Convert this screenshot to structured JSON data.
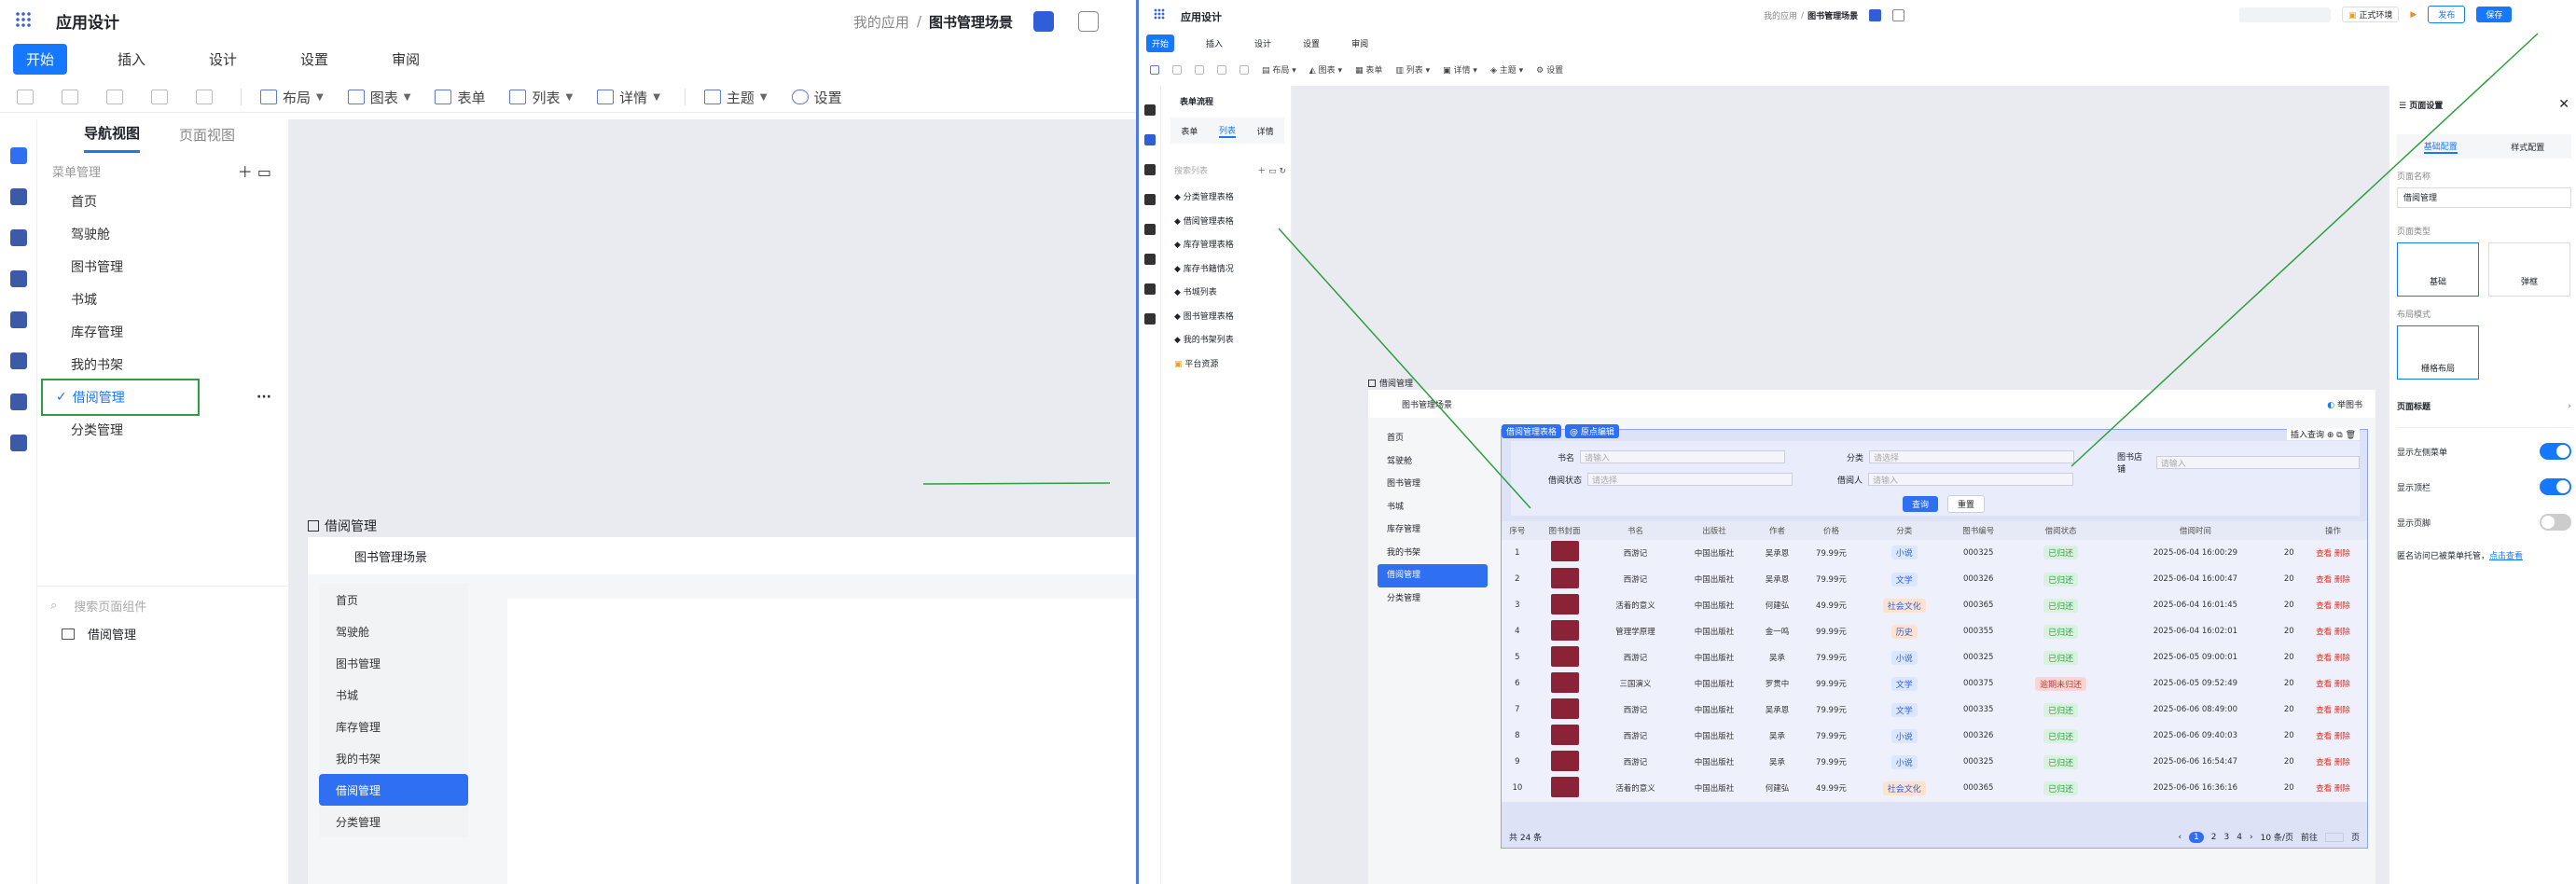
{
  "left": {
    "app_title": "应用设计",
    "breadcrumb": {
      "parent": "我的应用",
      "sep": "/",
      "current": "图书管理场景"
    },
    "tabs": [
      "开始",
      "插入",
      "设计",
      "设置",
      "审阅"
    ],
    "toolbar": {
      "layout": "布局",
      "chart": "图表",
      "form": "表单",
      "list": "列表",
      "detail": "详情",
      "theme": "主题",
      "settings": "设置"
    },
    "view_tabs": [
      "导航视图",
      "页面视图"
    ],
    "menu_section": "菜单管理",
    "menu_items": [
      "首页",
      "驾驶舱",
      "图书管理",
      "书城",
      "库存管理",
      "我的书架",
      "借阅管理",
      "分类管理"
    ],
    "more": "···",
    "search_placeholder": "搜索页面组件",
    "page_component": "借阅管理",
    "preview": {
      "title": "借阅管理",
      "scene": "图书管理场景",
      "menu": [
        "首页",
        "驾驶舱",
        "图书管理",
        "书城",
        "库存管理",
        "我的书架",
        "借阅管理",
        "分类管理"
      ]
    }
  },
  "right": {
    "app_title": "应用设计",
    "breadcrumb": {
      "parent": "我的应用",
      "sep": "/",
      "current": "图书管理场景"
    },
    "tabs": [
      "开始",
      "插入",
      "设计",
      "设置",
      "审阅"
    ],
    "env": "正式环境",
    "publish": "发布",
    "save": "保存",
    "toolbar": {
      "layout": "布局",
      "chart": "图表",
      "form": "表单",
      "list": "列表",
      "detail": "详情",
      "theme": "主题",
      "settings": "设置"
    },
    "flow_title": "表单流程",
    "flow_tabs": [
      "表单",
      "列表",
      "详情"
    ],
    "search_list": "搜索列表",
    "list_items": [
      "分类管理表格",
      "借阅管理表格",
      "库存管理表格",
      "库存书籍情况",
      "书城列表",
      "图书管理表格",
      "我的书架列表"
    ],
    "platform": "平台资源",
    "preview": {
      "title": "借阅管理",
      "scene": "图书管理场景",
      "book_btn": "举图书",
      "menu": [
        "首页",
        "驾驶舱",
        "图书管理",
        "书城",
        "库存管理",
        "我的书架",
        "借阅管理",
        "分类管理"
      ],
      "tag1": "借阅管理表格",
      "tag2": "@ 原点编辑",
      "actions": "插入查询",
      "filters": {
        "f1": "书名",
        "f1_ph": "请输入",
        "f2": "分类",
        "f2_ph": "请选择",
        "f3": "图书店铺",
        "f3_ph": "请输入",
        "f4": "借阅状态",
        "f4_ph": "请选择",
        "f5": "借阅人",
        "f5_ph": "请输入"
      },
      "query": "查询",
      "reset": "重置",
      "columns": [
        "序号",
        "图书封面",
        "书名",
        "出版社",
        "作者",
        "价格",
        "分类",
        "图书编号",
        "借阅状态",
        "借阅时间",
        "",
        "操作"
      ],
      "rows": [
        [
          "1",
          "",
          "西游记",
          "中国出版社",
          "吴承恩",
          "79.99元",
          "小说",
          "000325",
          "已归还",
          "2025-06-04 16:00:29",
          "20",
          "查看 删除"
        ],
        [
          "2",
          "",
          "西游记",
          "中国出版社",
          "吴承恩",
          "79.99元",
          "文学",
          "000326",
          "已归还",
          "2025-06-04 16:00:47",
          "20",
          "查看 删除"
        ],
        [
          "3",
          "",
          "活着的意义",
          "中国出版社",
          "何建弘",
          "49.99元",
          "社会文化",
          "000365",
          "已归还",
          "2025-06-04 16:01:45",
          "20",
          "查看 删除"
        ],
        [
          "4",
          "",
          "管理学原理",
          "中国出版社",
          "金一鸣",
          "99.99元",
          "历史",
          "000355",
          "已归还",
          "2025-06-04 16:02:01",
          "20",
          "查看 删除"
        ],
        [
          "5",
          "",
          "西游记",
          "中国出版社",
          "吴承",
          "79.99元",
          "小说",
          "000325",
          "已归还",
          "2025-06-05 09:00:01",
          "20",
          "查看 删除"
        ],
        [
          "6",
          "",
          "三国演义",
          "中国出版社",
          "罗贯中",
          "99.99元",
          "文学",
          "000375",
          "逾期未归还",
          "2025-06-05 09:52:49",
          "20",
          "查看 删除"
        ],
        [
          "7",
          "",
          "西游记",
          "中国出版社",
          "吴承恩",
          "79.99元",
          "文学",
          "000335",
          "已归还",
          "2025-06-06 08:49:00",
          "20",
          "查看 删除"
        ],
        [
          "8",
          "",
          "西游记",
          "中国出版社",
          "吴承",
          "79.99元",
          "小说",
          "000326",
          "已归还",
          "2025-06-06 09:40:03",
          "20",
          "查看 删除"
        ],
        [
          "9",
          "",
          "西游记",
          "中国出版社",
          "吴承",
          "79.99元",
          "小说",
          "000325",
          "已归还",
          "2025-06-06 16:54:47",
          "20",
          "查看 删除"
        ],
        [
          "10",
          "",
          "活着的意义",
          "中国出版社",
          "何建弘",
          "49.99元",
          "社会文化",
          "000365",
          "已归还",
          "2025-06-06 16:36:16",
          "20",
          "查看 删除"
        ]
      ],
      "total": "共 24 条",
      "pages": [
        "1",
        "2",
        "3",
        "4"
      ],
      "page_size": "10 条/页",
      "goto": "前往",
      "goto_page": "页"
    },
    "settings_panel": {
      "title": "页面设置",
      "tabs": [
        "基础配置",
        "样式配置"
      ],
      "name_label": "页面名称",
      "name_value": "借阅管理",
      "type_label": "页面类型",
      "type_basic": "基础",
      "type_popup": "弹框",
      "layout_label": "布局模式",
      "layout_grid": "栅格布局",
      "page_title": "页面标题",
      "show_left_menu": "显示左侧菜单",
      "show_top": "显示顶栏",
      "show_footer": "显示页脚",
      "anon_text": "匿名访问已被菜单托管，",
      "anon_link": "点击查看"
    }
  },
  "colors": {
    "accent": "#1677ff",
    "arrow": "#2e9e3f",
    "selected_bg": "#2f6ff2"
  }
}
